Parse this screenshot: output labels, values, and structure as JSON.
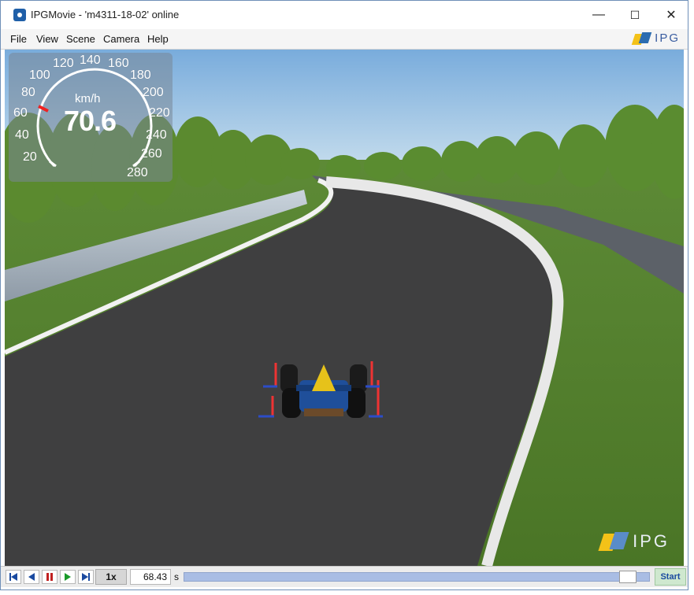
{
  "window": {
    "title": "IPGMovie - 'm4311-18-02' online",
    "controls": [
      "—",
      "☐",
      "✕"
    ]
  },
  "menu": {
    "items": [
      "File",
      "View",
      "Scene",
      "Camera",
      "Help"
    ],
    "brand": "IPG"
  },
  "speedometer": {
    "unit": "km/h",
    "value": "70.6",
    "ticks": [
      "20",
      "40",
      "60",
      "80",
      "100",
      "120",
      "140",
      "160",
      "180",
      "200",
      "220",
      "240",
      "260",
      "280"
    ]
  },
  "watermark": {
    "brand": "IPG"
  },
  "playback": {
    "speed": "1x",
    "time": "68.43",
    "unit": "s",
    "progress": 0.97,
    "start_label": "Start"
  },
  "colors": {
    "sky_top": "#7fb2e0",
    "grass": "#4f7a2c",
    "road": "#3f3f40",
    "accent_blue": "#2b6cb0"
  }
}
